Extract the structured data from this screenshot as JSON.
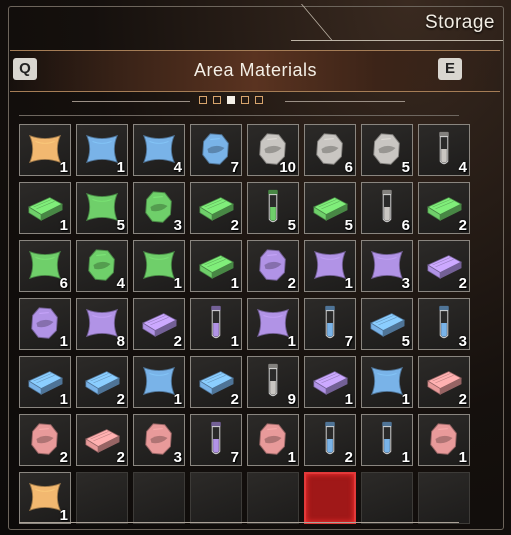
{
  "storage_title": "Storage",
  "header": {
    "title": "Area Materials",
    "prev_key": "Q",
    "next_key": "E",
    "pages": 5,
    "active_page": 3
  },
  "colors": {
    "orange": "#f2b870",
    "blue": "#79b3e8",
    "gray": "#c9c6c2",
    "green": "#6fcf6a",
    "purple": "#b193e6",
    "pink": "#e89a9a",
    "selected": "#b01e1e"
  },
  "slots": [
    {
      "icon": "crystal",
      "color": "orange",
      "qty": "1"
    },
    {
      "icon": "crystal",
      "color": "blue",
      "qty": "1"
    },
    {
      "icon": "crystal",
      "color": "blue",
      "qty": "4"
    },
    {
      "icon": "ore",
      "color": "blue",
      "qty": "7"
    },
    {
      "icon": "ore",
      "color": "gray",
      "qty": "10"
    },
    {
      "icon": "ore",
      "color": "gray",
      "qty": "6"
    },
    {
      "icon": "ore",
      "color": "gray",
      "qty": "5"
    },
    {
      "icon": "vial",
      "color": "gray",
      "qty": "4"
    },
    {
      "icon": "ingot",
      "color": "green",
      "qty": "1"
    },
    {
      "icon": "crystal",
      "color": "green",
      "qty": "5"
    },
    {
      "icon": "ore",
      "color": "green",
      "qty": "3"
    },
    {
      "icon": "ingot",
      "color": "green",
      "qty": "2"
    },
    {
      "icon": "vial",
      "color": "green",
      "qty": "5"
    },
    {
      "icon": "ingot",
      "color": "green",
      "qty": "5"
    },
    {
      "icon": "vial",
      "color": "gray",
      "qty": "6"
    },
    {
      "icon": "ingot",
      "color": "green",
      "qty": "2"
    },
    {
      "icon": "crystal",
      "color": "green",
      "qty": "6"
    },
    {
      "icon": "ore",
      "color": "green",
      "qty": "4"
    },
    {
      "icon": "crystal",
      "color": "green",
      "qty": "1"
    },
    {
      "icon": "ingot",
      "color": "green",
      "qty": "1"
    },
    {
      "icon": "ore",
      "color": "purple",
      "qty": "2"
    },
    {
      "icon": "crystal",
      "color": "purple",
      "qty": "1"
    },
    {
      "icon": "crystal",
      "color": "purple",
      "qty": "3"
    },
    {
      "icon": "ingot",
      "color": "purple",
      "qty": "2"
    },
    {
      "icon": "ore",
      "color": "purple",
      "qty": "1"
    },
    {
      "icon": "crystal",
      "color": "purple",
      "qty": "8"
    },
    {
      "icon": "ingot",
      "color": "purple",
      "qty": "2"
    },
    {
      "icon": "vial",
      "color": "purple",
      "qty": "1"
    },
    {
      "icon": "crystal",
      "color": "purple",
      "qty": "1"
    },
    {
      "icon": "vial",
      "color": "blue",
      "qty": "7"
    },
    {
      "icon": "ingot",
      "color": "blue",
      "qty": "5"
    },
    {
      "icon": "vial",
      "color": "blue",
      "qty": "3"
    },
    {
      "icon": "ingot",
      "color": "blue",
      "qty": "1"
    },
    {
      "icon": "ingot",
      "color": "blue",
      "qty": "2"
    },
    {
      "icon": "crystal",
      "color": "blue",
      "qty": "1"
    },
    {
      "icon": "ingot",
      "color": "blue",
      "qty": "2"
    },
    {
      "icon": "vial",
      "color": "gray",
      "qty": "9"
    },
    {
      "icon": "ingot",
      "color": "purple",
      "qty": "1"
    },
    {
      "icon": "crystal",
      "color": "blue",
      "qty": "1"
    },
    {
      "icon": "ingot",
      "color": "pink",
      "qty": "2"
    },
    {
      "icon": "ore",
      "color": "pink",
      "qty": "2"
    },
    {
      "icon": "ingot",
      "color": "pink",
      "qty": "2"
    },
    {
      "icon": "ore",
      "color": "pink",
      "qty": "3"
    },
    {
      "icon": "vial",
      "color": "purple",
      "qty": "7"
    },
    {
      "icon": "ore",
      "color": "pink",
      "qty": "1"
    },
    {
      "icon": "vial",
      "color": "blue",
      "qty": "2"
    },
    {
      "icon": "vial",
      "color": "blue",
      "qty": "1"
    },
    {
      "icon": "ore",
      "color": "pink",
      "qty": "1"
    },
    {
      "icon": "crystal",
      "color": "orange",
      "qty": "1"
    },
    {
      "icon": null,
      "color": null,
      "qty": null
    },
    {
      "icon": null,
      "color": null,
      "qty": null
    },
    {
      "icon": null,
      "color": null,
      "qty": null
    },
    {
      "icon": null,
      "color": null,
      "qty": null
    },
    {
      "icon": null,
      "color": null,
      "qty": null,
      "selected": true
    },
    {
      "icon": null,
      "color": null,
      "qty": null
    },
    {
      "icon": null,
      "color": null,
      "qty": null
    }
  ]
}
